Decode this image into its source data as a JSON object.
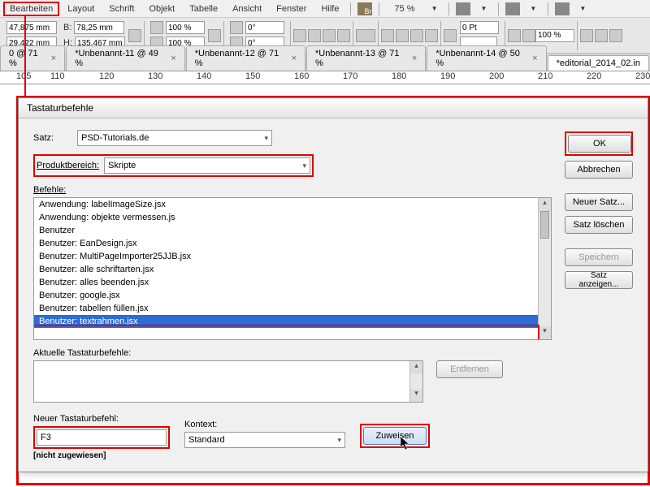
{
  "menu": {
    "items": [
      "Bearbeiten",
      "Layout",
      "Schrift",
      "Objekt",
      "Tabelle",
      "Ansicht",
      "Fenster",
      "Hilfe"
    ],
    "zoom": "75 %"
  },
  "controlbar": {
    "x": "47,875 mm",
    "y": "29,422 mm",
    "b_lbl": "B:",
    "b": "78,25 mm",
    "h_lbl": "H:",
    "h": "135,467 mm",
    "scale1": "100 %",
    "scale2": "100 %",
    "rot1": "0°",
    "rot2": "0°",
    "pt": "0 Pt",
    "pct": "100 %"
  },
  "tabs": [
    {
      "label": "0 @ 71 %"
    },
    {
      "label": "*Unbenannt-11 @ 49 %"
    },
    {
      "label": "*Unbenannt-12 @ 71 %"
    },
    {
      "label": "*Unbenannt-13 @ 71 %"
    },
    {
      "label": "*Unbenannt-14 @ 50 %"
    },
    {
      "label": "*editorial_2014_02.in"
    }
  ],
  "ruler": [
    "105",
    "110",
    "120",
    "130",
    "140",
    "150",
    "160",
    "170",
    "180",
    "190",
    "200",
    "210",
    "220",
    "230"
  ],
  "dialog": {
    "title": "Tastaturbefehle",
    "satz_lbl": "Satz:",
    "satz": "PSD-Tutorials.de",
    "prod_lbl": "Produktbereich:",
    "prod": "Skripte",
    "befehle_lbl": "Befehle:",
    "commands": [
      "Anwendung: labelImageSize.jsx",
      "Anwendung: objekte vermessen.js",
      "Benutzer",
      "Benutzer: EanDesign.jsx",
      "Benutzer: MultiPageImporter25JJB.jsx",
      "Benutzer: alle schriftarten.jsx",
      "Benutzer: alles beenden.jsx",
      "Benutzer: google.jsx",
      "Benutzer: tabellen füllen.jsx",
      "Benutzer: textrahmen.jsx"
    ],
    "selected_index": 9,
    "akt_lbl": "Aktuelle Tastaturbefehle:",
    "entfernen": "Entfernen",
    "neu_lbl": "Neuer Tastaturbefehl:",
    "neu_val": "F3",
    "kontext_lbl": "Kontext:",
    "kontext": "Standard",
    "zuweisen": "Zuweisen",
    "subnote": "[nicht zugewiesen]",
    "buttons": {
      "ok": "OK",
      "abbrechen": "Abbrechen",
      "neuer": "Neuer Satz...",
      "loeschen": "Satz löschen",
      "speichern": "Speichern",
      "anzeigen": "Satz anzeigen..."
    }
  }
}
